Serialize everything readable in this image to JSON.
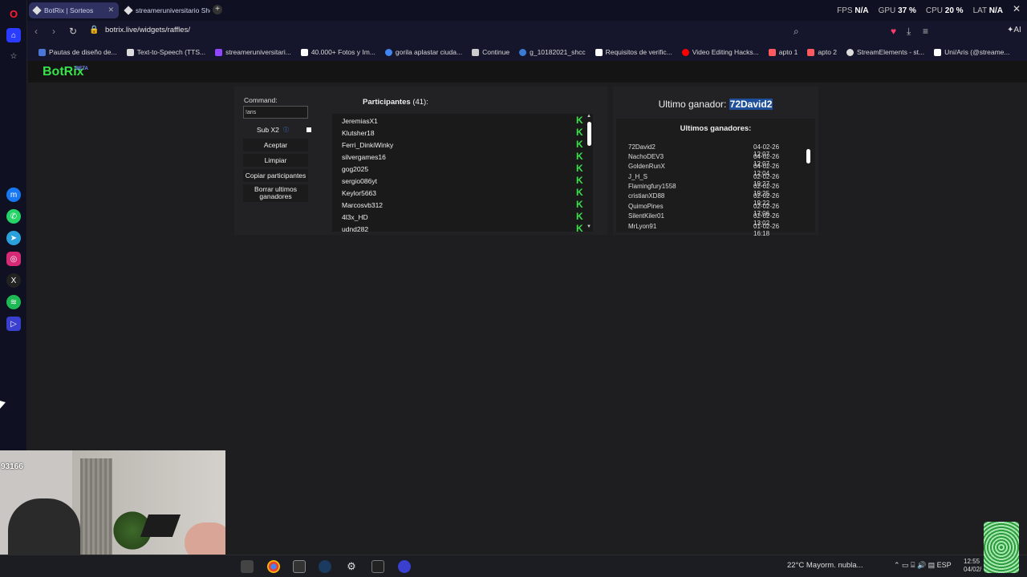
{
  "tabs": [
    {
      "title": "BotRix | Sorteos"
    },
    {
      "title": "streameruniversitario Shop"
    }
  ],
  "stats": {
    "fps_label": "FPS",
    "fps_value": "N/A",
    "gpu_label": "GPU",
    "gpu_value": "37 %",
    "cpu_label": "CPU",
    "cpu_value": "20 %",
    "lat_label": "LAT",
    "lat_value": "N/A"
  },
  "address": {
    "url": "botrix.live/widgets/raffles/"
  },
  "bookmarks": [
    {
      "label": "Pautas de diseño de...",
      "color": "#4a76d8"
    },
    {
      "label": "Text-to-Speech (TTS...",
      "color": "#dddddd"
    },
    {
      "label": "streameruniversitari...",
      "color": "#9146ff"
    },
    {
      "label": "40.000+ Fotos y Im...",
      "color": "#ffffff"
    },
    {
      "label": "gorila aplastar ciuda...",
      "color": "#4285f4"
    },
    {
      "label": "Continue",
      "color": "#cccccc"
    },
    {
      "label": "g_10182021_shcc",
      "color": "#3a7bd5"
    },
    {
      "label": "Requisitos de verific...",
      "color": "#ffffff"
    },
    {
      "label": "Video Editing Hacks...",
      "color": "#ff0000"
    },
    {
      "label": "apto 1",
      "color": "#ff5a5f"
    },
    {
      "label": "apto 2",
      "color": "#ff5a5f"
    },
    {
      "label": "StreamElements - st...",
      "color": "#dddddd"
    },
    {
      "label": "Uni/Aris (@streame...",
      "color": "#ffffff"
    }
  ],
  "brand": {
    "name": "BotRix",
    "badge": "BETA"
  },
  "raffle": {
    "command_label": "Command:",
    "command_value": "!aris",
    "sub_label": "Sub X2",
    "buttons": [
      "Aceptar",
      "Limpiar",
      "Copiar participantes",
      "Borrar ultimos ganadores"
    ],
    "participants_title": "Participantes",
    "participants_count": "(41):",
    "participants": [
      "JeremiasX1",
      "Klutsher18",
      "Ferri_DinkiWinky",
      "silvergames16",
      "gog2025",
      "sergio086yt",
      "Keylor5663",
      "Marcosvb312",
      "4l3x_HD",
      "udnd282"
    ]
  },
  "winner": {
    "last_label": "Ultimo ganador:",
    "last_name": "72David2",
    "list_title": "Ultimos ganadores:",
    "list": [
      {
        "name": "72David2",
        "date": "04-02-26 12:07"
      },
      {
        "name": "NachoDEV3",
        "date": "04-02-26 12:07"
      },
      {
        "name": "GoldenRunX",
        "date": "04-02-26 12:04"
      },
      {
        "name": "J_H_S",
        "date": "02-02-26 19:27"
      },
      {
        "name": "Flamingfury1558",
        "date": "02-02-26 19:25"
      },
      {
        "name": "cristianXD88",
        "date": "02-02-26 19:22"
      },
      {
        "name": "QuimoPines",
        "date": "02-02-26 17:06"
      },
      {
        "name": "SilentKiler01",
        "date": "02-02-26 13:02"
      },
      {
        "name": "MrLyon91",
        "date": "01-02-26 16:18"
      }
    ]
  },
  "webcam": {
    "count": "93166"
  },
  "taskbar": {
    "weather": "22°C  Mayorm. nubla...",
    "lang": "ESP",
    "time": "12:55",
    "date": "04/02/"
  },
  "colors": {
    "accent": "#38e04a",
    "highlight": "#1e4f9a"
  }
}
